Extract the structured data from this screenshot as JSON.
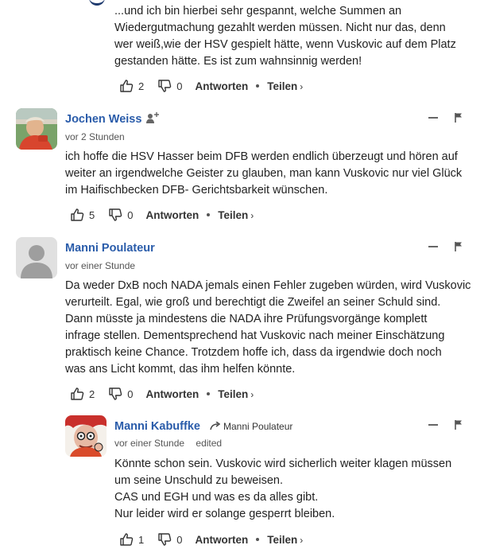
{
  "comment0": {
    "lines": [
      "...und ich bin hierbei sehr gespannt, welche Summen an",
      "Wiedergutmachung gezahlt werden müssen. Nicht nur das, denn",
      "wer weiß,wie der HSV gespielt hätte, wenn Vuskovic auf dem Platz",
      "gestanden hätte. Es ist zum wahnsinnig werden!"
    ],
    "likes": "2",
    "dislikes": "0",
    "reply_label": "Antworten",
    "share_label": "Teilen"
  },
  "comment1": {
    "author": "Jochen Weiss",
    "time": "vor 2 Stunden",
    "lines": [
      "ich hoffe die HSV Hasser beim DFB werden endlich überzeugt und hören auf",
      "weiter an irgendwelche Geister zu glauben, man kann Vuskovic nur viel Glück",
      "im Haifischbecken DFB- Gerichtsbarkeit wünschen."
    ],
    "likes": "5",
    "dislikes": "0",
    "reply_label": "Antworten",
    "share_label": "Teilen"
  },
  "comment2": {
    "author": "Manni Poulateur",
    "time": "vor einer Stunde",
    "lines": [
      "Da weder DxB noch NADA jemals einen Fehler zugeben würden, wird Vuskovic",
      "verurteilt. Egal, wie groß und berechtigt die Zweifel an seiner Schuld sind.",
      "Dann müsste ja mindestens die NADA ihre Prüfungsvorgänge komplett",
      "infrage stellen. Dementsprechend hat Vuskovic nach meiner Einschätzung",
      "praktisch keine Chance. Trotzdem hoffe ich, dass da irgendwie doch noch",
      "was ans Licht kommt, das ihm helfen könnte."
    ],
    "likes": "2",
    "dislikes": "0",
    "reply_label": "Antworten",
    "share_label": "Teilen"
  },
  "comment3": {
    "author": "Manni Kabuffke",
    "reply_to": "Manni Poulateur",
    "time": "vor einer Stunde",
    "edited": "edited",
    "lines": [
      "Könnte schon sein. Vuskovic wird sicherlich weiter klagen müssen",
      "um seine Unschuld zu beweisen.",
      "CAS und EGH und was es da alles gibt.",
      "Nur leider wird er solange gesperrt bleiben."
    ],
    "likes": "1",
    "dislikes": "0",
    "reply_label": "Antworten",
    "share_label": "Teilen"
  },
  "icons": {
    "thumb_up": "thumb-up-icon",
    "thumb_down": "thumb-down-icon",
    "follow": "follow-user-icon",
    "collapse": "minus-icon",
    "flag": "flag-icon",
    "reply_arrow": "reply-arrow-icon"
  },
  "colors": {
    "author": "#2a5caa",
    "text": "#222222"
  }
}
